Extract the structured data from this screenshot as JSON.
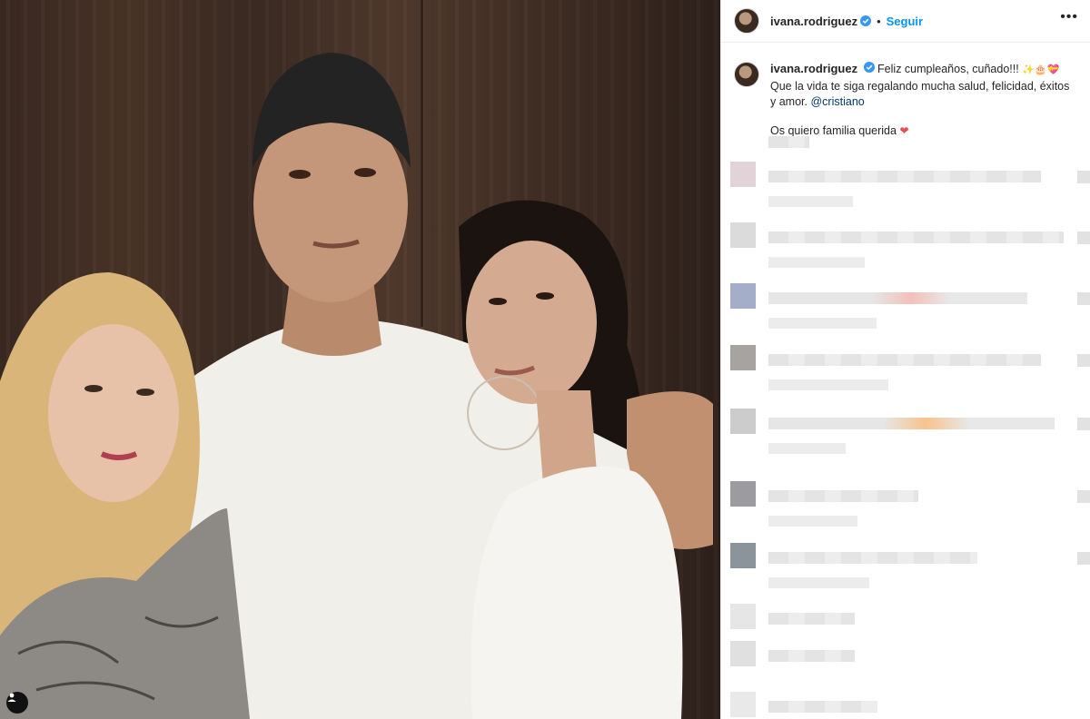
{
  "post": {
    "username": "ivana.rodriguez",
    "follow_label": "Seguir",
    "more_icon": "more-horizontal-icon",
    "verified_icon": "verified-badge-icon"
  },
  "caption": {
    "username": "ivana.rodriguez",
    "line1": "Feliz cumpleaños, cuñado!!!",
    "line1_emojis": "✨🎂💝",
    "line2": "Que la vida te siga regalando mucha salud, felicidad, éxitos y amor.",
    "mention": "@cristiano",
    "line3": "Os quiero familia querida",
    "line3_emoji": "❤"
  },
  "colors": {
    "follow": "#0095f6",
    "mention": "#00376b",
    "text": "#262626",
    "heart": "#ed4956",
    "verified": "#3897f0"
  }
}
